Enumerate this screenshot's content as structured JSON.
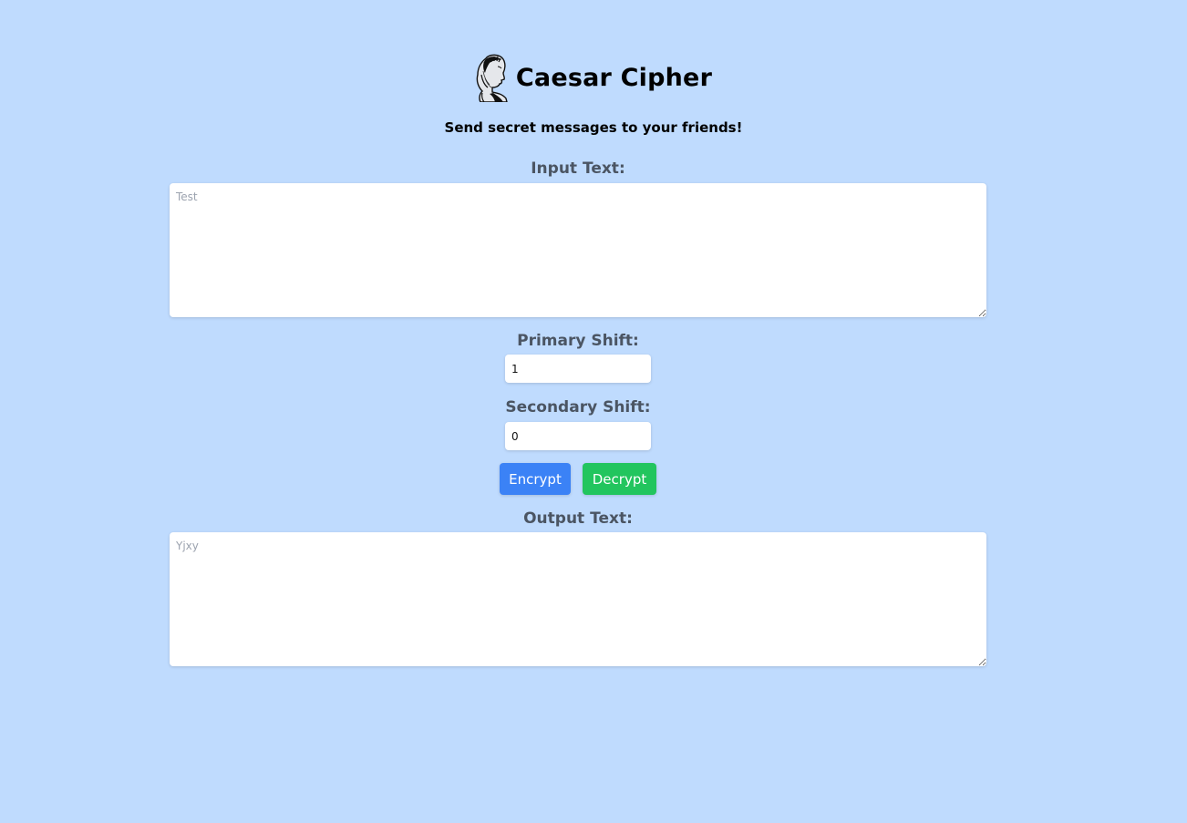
{
  "header": {
    "title": "Caesar Cipher",
    "subtitle": "Send secret messages to your friends!",
    "logo_icon": "caesar-bust-icon"
  },
  "input": {
    "label": "Input Text:",
    "placeholder": "Test",
    "value": ""
  },
  "primary_shift": {
    "label": "Primary Shift:",
    "value": "1"
  },
  "secondary_shift": {
    "label": "Secondary Shift:",
    "value": "0"
  },
  "buttons": {
    "encrypt": "Encrypt",
    "decrypt": "Decrypt"
  },
  "output": {
    "label": "Output Text:",
    "placeholder": "Yjxy",
    "value": ""
  },
  "colors": {
    "background": "#bfdbfe",
    "encrypt": "#3b82f6",
    "decrypt": "#22c55e",
    "label": "#4b5563"
  }
}
